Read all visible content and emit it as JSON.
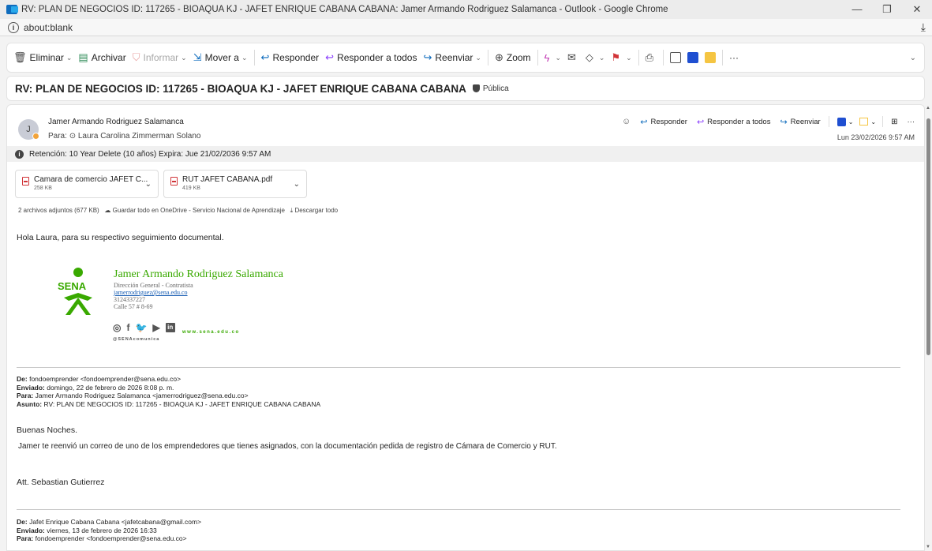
{
  "window": {
    "title": "RV: PLAN DE NEGOCIOS ID: 117265 - BIOAQUA KJ - JAFET ENRIQUE CABANA CABANA: Jamer Armando Rodriguez Salamanca - Outlook - Google Chrome",
    "minimize": "—",
    "restore": "❐",
    "close": "✕"
  },
  "address_bar": {
    "url": "about:blank"
  },
  "toolbar": {
    "eliminar": "Eliminar",
    "archivar": "Archivar",
    "informar": "Informar",
    "mover": "Mover a",
    "responder": "Responder",
    "responder_todos": "Responder a todos",
    "reenviar": "Reenviar",
    "zoom": "Zoom",
    "more": "···"
  },
  "subject": {
    "text": "RV: PLAN DE NEGOCIOS ID: 117265 - BIOAQUA KJ - JAFET ENRIQUE CABANA CABANA",
    "sensitivity": "Pública"
  },
  "message": {
    "avatar_initial": "J",
    "sender": "Jamer Armando Rodriguez Salamanca",
    "to_label": "Para:",
    "to": "Laura Carolina Zimmerman Solano",
    "date": "Lun 23/02/2026 9:57 AM",
    "actions": {
      "responder": "Responder",
      "responder_todos": "Responder a todos",
      "reenviar": "Reenviar",
      "more": "···"
    },
    "retention": "Retención: 10 Year Delete (10 años) Expira: Jue 21/02/2036 9:57 AM"
  },
  "attachments": {
    "items": [
      {
        "name": "Camara de comercio JAFET C...",
        "size": "258 KB"
      },
      {
        "name": "RUT JAFET CABANA.pdf",
        "size": "419 KB"
      }
    ],
    "summary": "2 archivos adjuntos (677 KB)",
    "save_onedrive": "Guardar todo en OneDrive - Servicio Nacional de Aprendizaje",
    "download_all": "Descargar todo"
  },
  "body": {
    "greeting": "Hola Laura, para su respectivo seguimiento documental.",
    "signature": {
      "logo_text": "SENA",
      "name": "Jamer Armando Rodriguez Salamanca",
      "role": "Dirección General - Contratista",
      "email": "jamerrodriguez@sena.edu.co",
      "phone": "3124337227",
      "address": "Calle 57 # 8-69",
      "handle": "@SENAcomunica",
      "website": "www.sena.edu.co"
    },
    "forward1": {
      "from_label": "De:",
      "from": "fondoemprender <fondoemprender@sena.edu.co>",
      "sent_label": "Enviado:",
      "sent": "domingo, 22 de febrero de 2026 8:08 p. m.",
      "to_label": "Para:",
      "to": "Jamer Armando Rodriguez Salamanca <jamerrodriguez@sena.edu.co>",
      "subject_label": "Asunto:",
      "subject": "RV: PLAN DE NEGOCIOS ID: 117265 - BIOAQUA KJ - JAFET ENRIQUE CABANA CABANA"
    },
    "line_buenas": "Buenas Noches.",
    "line_jamer": "Jamer te reenvió un correo de uno de los emprendedores que tienes asignados, con la documentación pedida de registro de Cámara de Comercio y RUT.",
    "line_att": "Att. Sebastian Gutierrez",
    "forward2": {
      "from_label": "De:",
      "from": "Jafet Enrique Cabana Cabana <jafetcabana@gmail.com>",
      "sent_label": "Enviado:",
      "sent": "viernes, 13 de febrero de 2026 16:33",
      "to_label": "Para:",
      "to": "fondoemprender <fondoemprender@sena.edu.co>"
    }
  }
}
